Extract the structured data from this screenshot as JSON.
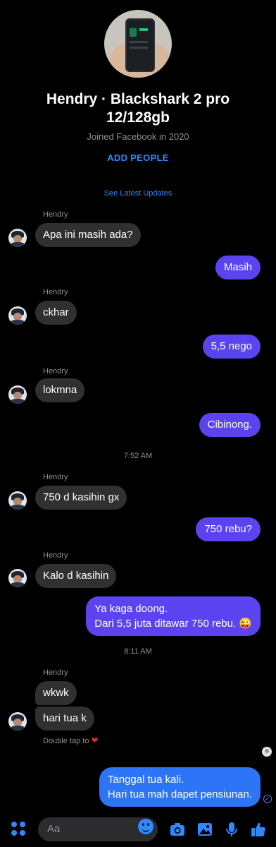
{
  "header": {
    "name": "Hendry · Blackshark 2 pro 12/128gb",
    "joined": "Joined Facebook in 2020",
    "add_people": "ADD PEOPLE",
    "see_latest": "See Latest Updates"
  },
  "messages": [
    {
      "sender": "Hendry",
      "text": "Apa ini masih ada?"
    },
    {
      "text": "Masih"
    },
    {
      "sender": "Hendry",
      "text": "ckhar"
    },
    {
      "text": "5,5 nego"
    },
    {
      "sender": "Hendry",
      "text": "lokmna"
    },
    {
      "text": "Cibinong."
    },
    {
      "time": "7:52 AM"
    },
    {
      "sender": "Hendry",
      "text": "750 d kasihin gx"
    },
    {
      "text": "750 rebu?"
    },
    {
      "sender": "Hendry",
      "text": "Kalo d kasihin"
    },
    {
      "text": "Ya kaga doong.\nDari 5,5 juta ditawar 750 rebu. 😜"
    },
    {
      "time": "8:11 AM"
    },
    {
      "sender": "Hendry",
      "text": "wkwk"
    },
    {
      "text": "hari tua k"
    },
    {
      "text": "Double tap to"
    },
    {
      "text": "Tanggal tua kali.\nHari tua mah dapet pensiunan."
    }
  ],
  "composer": {
    "placeholder": "Aa",
    "icons": [
      "menu-icon",
      "emoji-icon",
      "camera-icon",
      "gallery-icon",
      "microphone-icon",
      "like-icon"
    ]
  },
  "colors": {
    "accent": "#2e89ff",
    "outgoing_bubble": "#5b43f0",
    "incoming_bubble": "#303030",
    "background": "#000000"
  }
}
